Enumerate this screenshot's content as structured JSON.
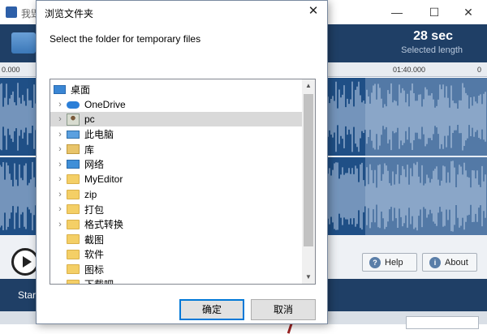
{
  "background_app": {
    "title_partial": "我毁",
    "window_controls": {
      "minimize": "—",
      "maximize": "☐",
      "close": "✕"
    },
    "selected_length": {
      "value": "28 sec",
      "label": "Selected length"
    },
    "timeline_labels": [
      "0.000",
      "01:40.000",
      "0"
    ],
    "buttons": {
      "help": "Help",
      "about": "About"
    },
    "start_label": "Star"
  },
  "dialog": {
    "title": "浏览文件夹",
    "close_glyph": "✕",
    "prompt": "Select the folder for temporary files",
    "tree": [
      {
        "label": "桌面",
        "icon": "desktop-icon",
        "indent": 0,
        "expandable": false
      },
      {
        "label": "OneDrive",
        "icon": "cloud-icon",
        "indent": 1,
        "expandable": true
      },
      {
        "label": "pc",
        "icon": "user-icon",
        "indent": 1,
        "expandable": true,
        "selected": true
      },
      {
        "label": "此电脑",
        "icon": "computer-icon",
        "indent": 1,
        "expandable": true
      },
      {
        "label": "库",
        "icon": "library-icon",
        "indent": 1,
        "expandable": true
      },
      {
        "label": "网络",
        "icon": "network-icon",
        "indent": 1,
        "expandable": true
      },
      {
        "label": "MyEditor",
        "icon": "folder-icon",
        "indent": 1,
        "expandable": true
      },
      {
        "label": "zip",
        "icon": "folder-icon",
        "indent": 1,
        "expandable": true
      },
      {
        "label": "打包",
        "icon": "folder-icon",
        "indent": 1,
        "expandable": true
      },
      {
        "label": "格式转换",
        "icon": "folder-icon",
        "indent": 1,
        "expandable": true
      },
      {
        "label": "截图",
        "icon": "folder-icon",
        "indent": 1,
        "expandable": false
      },
      {
        "label": "软件",
        "icon": "folder-icon",
        "indent": 1,
        "expandable": false
      },
      {
        "label": "图标",
        "icon": "folder-icon",
        "indent": 1,
        "expandable": false
      },
      {
        "label": "下载吧",
        "icon": "folder-icon",
        "indent": 1,
        "expandable": false
      }
    ],
    "ok_label": "确定",
    "cancel_label": "取消"
  },
  "colors": {
    "header_bg": "#1f3f66",
    "wave_bg": "#1f4f86",
    "accent": "#0078d7"
  }
}
